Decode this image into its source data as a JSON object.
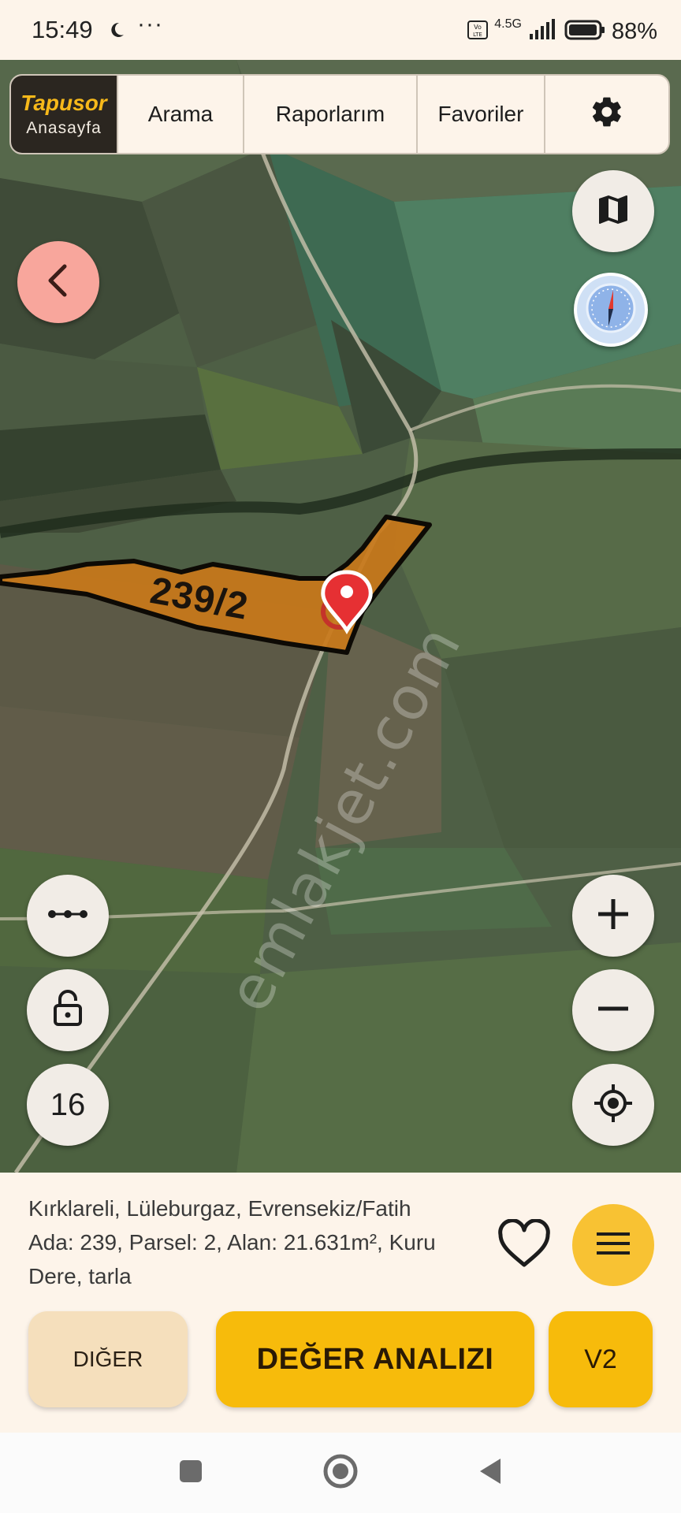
{
  "status_bar": {
    "time": "15:49",
    "network": "4.5G",
    "battery": "88%"
  },
  "top_nav": {
    "brand_name": "Tapusor",
    "brand_sub": "Anasayfa",
    "items": [
      "Arama",
      "Raporlarım",
      "Favoriler"
    ],
    "settings_icon": "gear-icon"
  },
  "map": {
    "parcel_label": "239/2",
    "watermark": "emlakjet.com",
    "zoom_level": "16",
    "icons": {
      "back": "chevron-left-icon",
      "layers": "map-icon",
      "compass": "compass-icon",
      "measure": "ruler-icon",
      "lock": "lock-open-icon",
      "zoom_in": "plus-icon",
      "zoom_out": "minus-icon",
      "locate": "crosshair-icon"
    }
  },
  "info": {
    "address_lines": [
      "Kırklareli, Lüleburgaz, Evrensekiz/Fatih",
      "Ada: 239, Parsel: 2, Alan: 21.631m², Kuru",
      "Dere, tarla"
    ]
  },
  "actions": {
    "other_label": "DIĞER",
    "value_analysis_label": "DEĞER ANALIZI",
    "version_label": "V2"
  },
  "colors": {
    "accent": "#f7bb0b",
    "brand_dark": "#2b2620",
    "parcel_fill": "#c9781a",
    "back_button": "#f8a69c"
  }
}
